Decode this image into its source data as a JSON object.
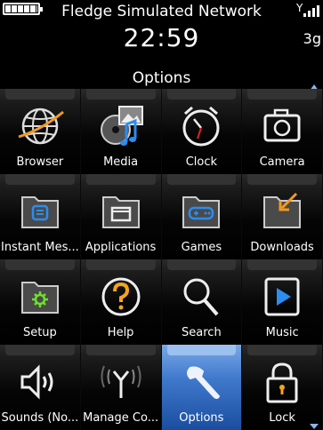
{
  "status": {
    "network_name": "Fledge Simulated Network",
    "time": "22:59",
    "network_type": "3g",
    "battery_icon": "battery-full-icon",
    "signal_icon": "signal-strength-icon"
  },
  "screen": {
    "title": "Options"
  },
  "apps": [
    {
      "label": "Browser",
      "icon": "globe-icon"
    },
    {
      "label": "Media",
      "icon": "media-icon"
    },
    {
      "label": "Clock",
      "icon": "alarm-clock-icon"
    },
    {
      "label": "Camera",
      "icon": "camera-icon"
    },
    {
      "label": "Instant Mes...",
      "icon": "chat-folder-icon"
    },
    {
      "label": "Applications",
      "icon": "applications-folder-icon"
    },
    {
      "label": "Games",
      "icon": "gamepad-folder-icon"
    },
    {
      "label": "Downloads",
      "icon": "downloads-folder-icon"
    },
    {
      "label": "Setup",
      "icon": "setup-folder-icon"
    },
    {
      "label": "Help",
      "icon": "help-icon"
    },
    {
      "label": "Search",
      "icon": "magnifier-icon"
    },
    {
      "label": "Music",
      "icon": "play-icon"
    },
    {
      "label": "Sounds (No...",
      "icon": "speaker-icon"
    },
    {
      "label": "Manage Co...",
      "icon": "antenna-icon"
    },
    {
      "label": "Options",
      "icon": "wrench-icon",
      "selected": true
    },
    {
      "label": "Lock",
      "icon": "padlock-icon"
    }
  ],
  "colors": {
    "selection": "#3f79cc",
    "scroll_arrow": "#8fb2e8"
  }
}
